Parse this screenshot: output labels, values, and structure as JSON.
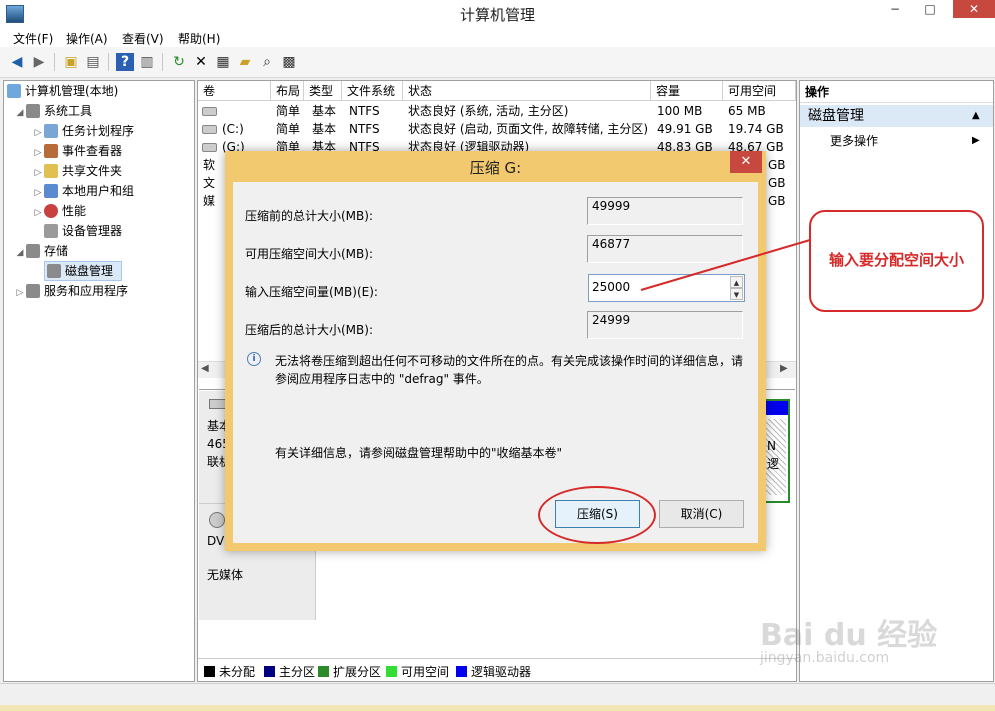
{
  "window": {
    "title": "计算机管理",
    "minimize": "−",
    "maximize": "□",
    "close": "✕"
  },
  "menu": [
    "文件(F)",
    "操作(A)",
    "查看(V)",
    "帮助(H)"
  ],
  "tree": {
    "root": "计算机管理(本地)",
    "system_tools": "系统工具",
    "task_scheduler": "任务计划程序",
    "event_viewer": "事件查看器",
    "shared_folders": "共享文件夹",
    "local_users": "本地用户和组",
    "performance": "性能",
    "device_manager": "设备管理器",
    "storage": "存储",
    "disk_management": "磁盘管理",
    "services": "服务和应用程序"
  },
  "volume_table": {
    "headers": [
      "卷",
      "布局",
      "类型",
      "文件系统",
      "状态",
      "容量",
      "可用空间"
    ],
    "rows": [
      {
        "vol": "",
        "layout": "简单",
        "type": "基本",
        "fs": "NTFS",
        "status": "状态良好 (系统, 活动, 主分区)",
        "cap": "100 MB",
        "free": "65 MB"
      },
      {
        "vol": "(C:)",
        "layout": "简单",
        "type": "基本",
        "fs": "NTFS",
        "status": "状态良好 (启动, 页面文件, 故障转储, 主分区)",
        "cap": "49.91 GB",
        "free": "19.74 GB"
      },
      {
        "vol": "(G:)",
        "layout": "简单",
        "type": "基本",
        "fs": "NTFS",
        "status": "状态良好 (逻辑驱动器)",
        "cap": "48.83 GB",
        "free": "48.67 GB"
      }
    ],
    "partial_vol": [
      "软",
      "文",
      "媒"
    ],
    "partial_free": [
      "GB",
      "GB",
      "GB"
    ]
  },
  "disk_area": {
    "disk0": [
      "基本",
      "465",
      "联机"
    ],
    "partition_frag": [
      "N",
      "逻"
    ],
    "cdrom": [
      "DV",
      "无媒体"
    ]
  },
  "legend": [
    "未分配",
    "主分区",
    "扩展分区",
    "可用空间",
    "逻辑驱动器"
  ],
  "legend_colors": [
    "#000000",
    "#000080",
    "#2a8a2a",
    "#33dd33",
    "#0000ee"
  ],
  "actions": {
    "header": "操作",
    "section": "磁盘管理",
    "more": "更多操作"
  },
  "dialog": {
    "title": "压缩 G:",
    "close": "✕",
    "total_before_label": "压缩前的总计大小(MB):",
    "total_before_value": "49999",
    "available_label": "可用压缩空间大小(MB):",
    "available_value": "46877",
    "input_label": "输入压缩空间量(MB)(E):",
    "input_value": "25000",
    "total_after_label": "压缩后的总计大小(MB):",
    "total_after_value": "24999",
    "info_text_1": "无法将卷压缩到超出任何不可移动的文件所在的点。有关完成该操作时间的详细信息，请",
    "info_text_2": "参阅应用程序日志中的 \"defrag\" 事件。",
    "help_text": "有关详细信息，请参阅磁盘管理帮助中的\"收缩基本卷\"",
    "shrink_button": "压缩(S)",
    "cancel_button": "取消(C)"
  },
  "annotation": {
    "text": "输入要分配空间大小",
    "color": "#d62a2a"
  },
  "watermark": {
    "main": "Bai du 经验",
    "sub": "jingyan.baidu.com"
  }
}
